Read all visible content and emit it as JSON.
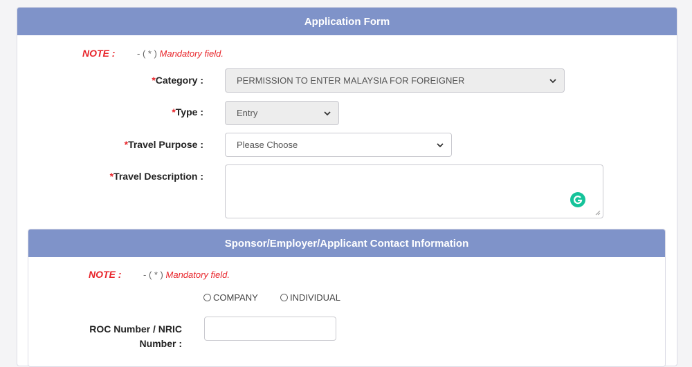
{
  "form": {
    "title": "Application Form",
    "note_label": "NOTE :",
    "note_dash": "- ( * )",
    "note_text": "Mandatory field.",
    "category": {
      "star": "*",
      "label": "Category :",
      "value": "PERMISSION TO ENTER MALAYSIA FOR FOREIGNER"
    },
    "type": {
      "star": "*",
      "label": "Type :",
      "value": "Entry"
    },
    "travel_purpose": {
      "star": "*",
      "label": "Travel Purpose :",
      "value": "Please Choose"
    },
    "travel_description": {
      "star": "*",
      "label": "Travel Description :",
      "value": ""
    }
  },
  "contact": {
    "title": "Sponsor/Employer/Applicant Contact Information",
    "note_label": "NOTE :",
    "note_dash": "- ( * )",
    "note_text": "Mandatory field.",
    "radio_options": [
      "COMPANY",
      "INDIVIDUAL"
    ],
    "roc_label_line1": "ROC Number / NRIC",
    "roc_label_line2": "Number :",
    "roc_value": ""
  },
  "icons": {
    "grammarly": "grammarly-icon",
    "select_arrow": "chevron-down-icon"
  },
  "colors": {
    "header": "#7f93c9",
    "accent_red": "#e8242a",
    "grammarly": "#15c39a"
  }
}
